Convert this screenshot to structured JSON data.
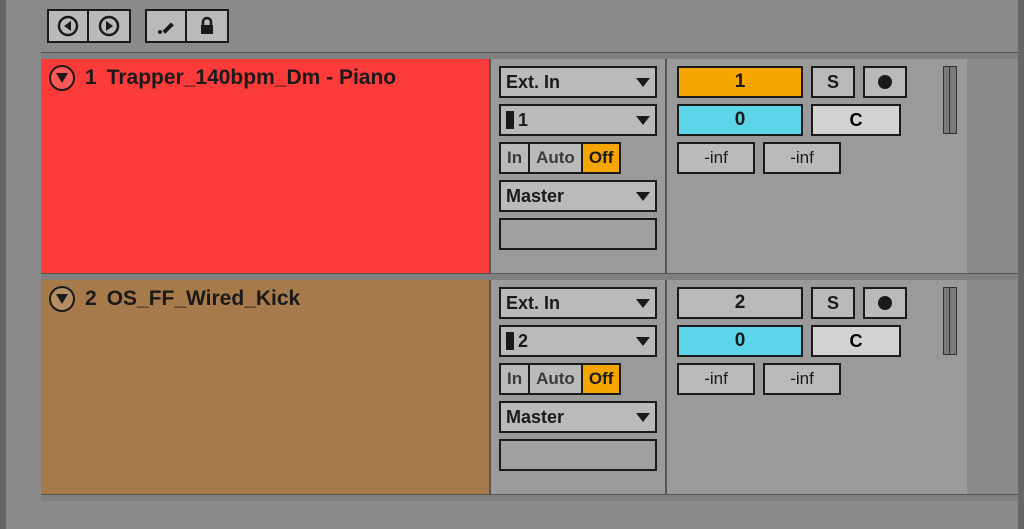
{
  "topbar": {
    "back": "back",
    "forward": "forward",
    "pencil": "pencil",
    "lock": "lock"
  },
  "tracks": [
    {
      "num": "1",
      "name": "Trapper_140bpm_Dm - Piano",
      "io": {
        "input_type": "Ext. In",
        "input_channel": "1",
        "monitor": {
          "in": "In",
          "auto": "Auto",
          "off": "Off"
        },
        "output": "Master"
      },
      "mix": {
        "activator": "1",
        "activator_style": "orange",
        "solo": "S",
        "pan": "0",
        "cue": "C",
        "sendA": "-inf",
        "sendB": "-inf"
      }
    },
    {
      "num": "2",
      "name": "OS_FF_Wired_Kick",
      "io": {
        "input_type": "Ext. In",
        "input_channel": "2",
        "monitor": {
          "in": "In",
          "auto": "Auto",
          "off": "Off"
        },
        "output": "Master"
      },
      "mix": {
        "activator": "2",
        "activator_style": "grey",
        "solo": "S",
        "pan": "0",
        "cue": "C",
        "sendA": "-inf",
        "sendB": "-inf"
      }
    }
  ]
}
